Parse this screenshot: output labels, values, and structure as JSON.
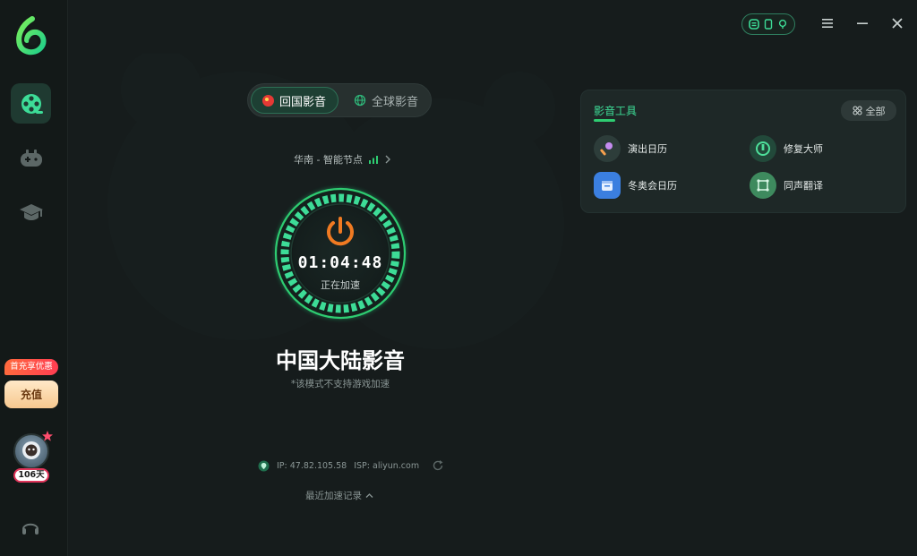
{
  "sidebar": {
    "promo_badge": "首充享优惠",
    "recharge_label": "充值",
    "member_days": "106天",
    "nav_items": [
      {
        "icon": "film-reel-icon",
        "active": true
      },
      {
        "icon": "gamepad-icon",
        "active": false
      },
      {
        "icon": "graduation-cap-icon",
        "active": false
      }
    ],
    "support_icon": "headset-icon"
  },
  "header": {
    "controls": [
      "menu-icon",
      "minimize-icon",
      "close-icon"
    ]
  },
  "mode": {
    "tabs": [
      {
        "label": "回国影音",
        "active": true,
        "icon": "china-flag-icon"
      },
      {
        "label": "全球影音",
        "active": false,
        "icon": "globe-icon"
      }
    ]
  },
  "node": {
    "label": "华南 - 智能节点"
  },
  "accelerator": {
    "timer": "01:04:48",
    "status": "正在加速",
    "region_title": "中国大陆影音",
    "region_note": "*该模式不支持游戏加速"
  },
  "connection": {
    "ip": "IP: 47.82.105.58",
    "isp": "ISP: aliyun.com"
  },
  "history": {
    "label": "最近加速记录"
  },
  "tools": {
    "title": "影音工具",
    "all_label": "全部",
    "items": [
      {
        "label": "演出日历",
        "icon": "microphone-icon"
      },
      {
        "label": "修复大师",
        "icon": "repair-icon"
      },
      {
        "label": "冬奥会日历",
        "icon": "calendar-icon"
      },
      {
        "label": "同声翻译",
        "icon": "translate-icon"
      }
    ]
  },
  "colors": {
    "accent": "#2ecc71",
    "background": "#161c1c",
    "power": "#f07a22"
  }
}
